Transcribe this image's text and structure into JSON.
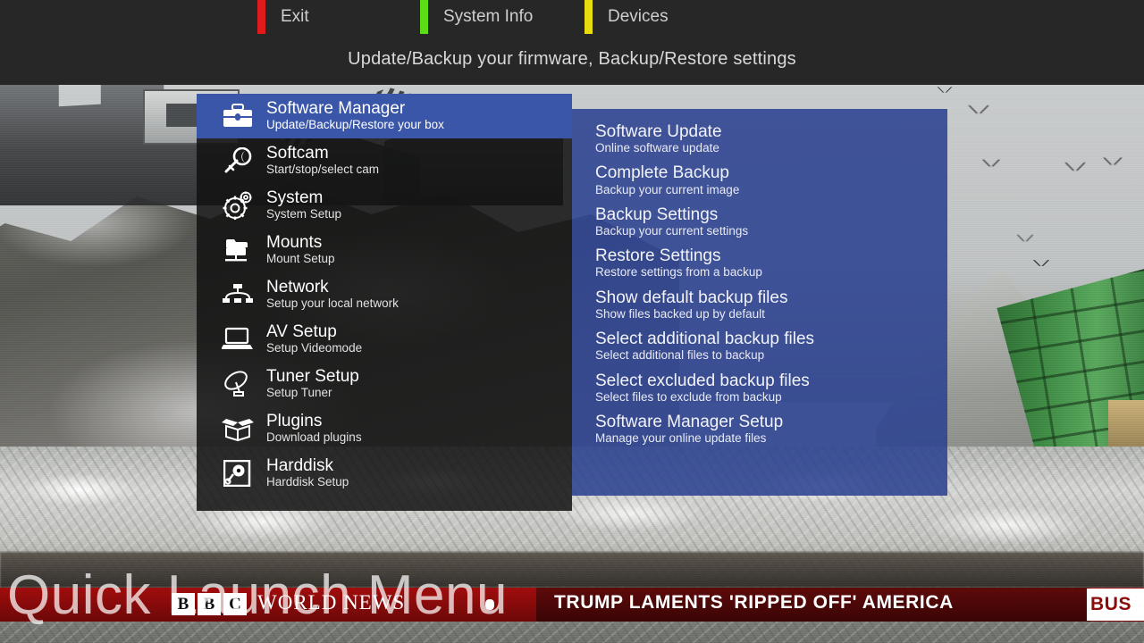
{
  "top_bar": {
    "subtitle": "Update/Backup your firmware, Backup/Restore settings",
    "color_keys": [
      {
        "name": "exit",
        "label": "Exit",
        "color": "#e01b1b"
      },
      {
        "name": "system-info",
        "label": "System Info",
        "color": "#5cdc16"
      },
      {
        "name": "devices",
        "label": "Devices",
        "color": "#e8dc10"
      }
    ]
  },
  "left_menu": {
    "items": [
      {
        "title": "Software Manager",
        "subtitle": "Update/Backup/Restore your box",
        "icon": "briefcase-icon",
        "selected": true
      },
      {
        "title": "Softcam",
        "subtitle": "Start/stop/select cam",
        "icon": "key-icon",
        "selected": false
      },
      {
        "title": "System",
        "subtitle": "System Setup",
        "icon": "gears-icon",
        "selected": false
      },
      {
        "title": "Mounts",
        "subtitle": "Mount Setup",
        "icon": "network-drive-icon",
        "selected": false
      },
      {
        "title": "Network",
        "subtitle": "Setup your local network",
        "icon": "network-tree-icon",
        "selected": false
      },
      {
        "title": "AV Setup",
        "subtitle": "Setup Videomode",
        "icon": "laptop-icon",
        "selected": false
      },
      {
        "title": "Tuner Setup",
        "subtitle": "Setup Tuner",
        "icon": "satellite-dish-icon",
        "selected": false
      },
      {
        "title": "Plugins",
        "subtitle": "Download plugins",
        "icon": "open-box-icon",
        "selected": false
      },
      {
        "title": "Harddisk",
        "subtitle": "Harddisk Setup",
        "icon": "harddisk-icon",
        "selected": false
      }
    ]
  },
  "right_panel": {
    "accent_color": "#2c4291",
    "items": [
      {
        "title": "Software Update",
        "subtitle": "Online software update"
      },
      {
        "title": "Complete Backup",
        "subtitle": "Backup your current image"
      },
      {
        "title": "Backup Settings",
        "subtitle": "Backup your current settings"
      },
      {
        "title": "Restore Settings",
        "subtitle": "Restore settings from a backup"
      },
      {
        "title": "Show default backup files",
        "subtitle": "Show files backed up by default"
      },
      {
        "title": "Select additional backup files",
        "subtitle": "Select additional files to backup"
      },
      {
        "title": "Select excluded backup files",
        "subtitle": "Select files to exclude from backup"
      },
      {
        "title": "Software Manager Setup",
        "subtitle": "Manage your online update files"
      }
    ]
  },
  "watermark": {
    "text": "Quick Launch Menu"
  },
  "ticker": {
    "logo_letters": [
      "B",
      "B",
      "C"
    ],
    "brand": "WORLD NEWS",
    "headline": "TRUMP LAMENTS 'RIPPED OFF' AMERICA",
    "next_headline": "BUS",
    "band_color": "#8c0b0b"
  },
  "selection": {
    "highlight_color": "#3a56a8"
  }
}
